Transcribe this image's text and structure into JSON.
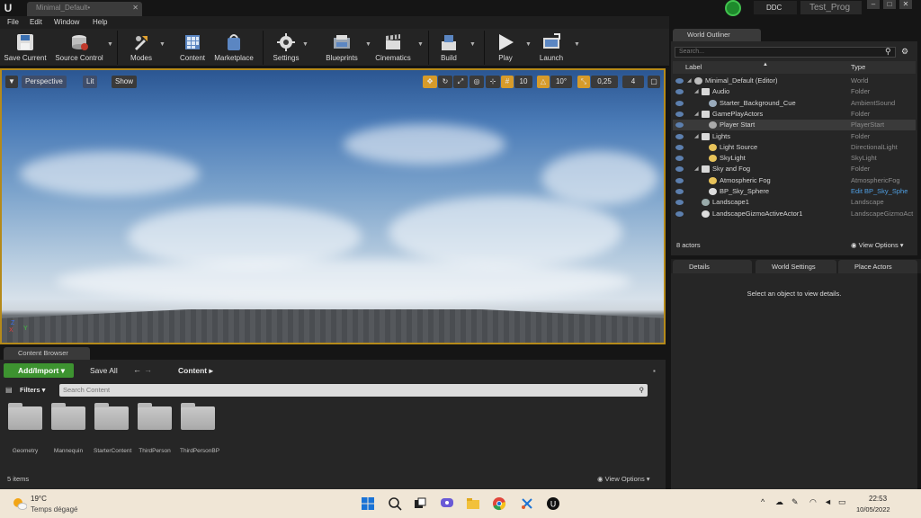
{
  "titlebar": {
    "document_tab": "Minimal_Default•",
    "ddc_label": "DDC",
    "project_name": "Test_Prog"
  },
  "menu": [
    "File",
    "Edit",
    "Window",
    "Help"
  ],
  "toolbar": {
    "buttons": [
      {
        "label": "Save Current",
        "icon": "save-icon"
      },
      {
        "label": "Source Control",
        "icon": "source-control-icon"
      },
      {
        "label": "Modes",
        "icon": "modes-icon"
      },
      {
        "label": "Content",
        "icon": "content-icon"
      },
      {
        "label": "Marketplace",
        "icon": "marketplace-icon"
      },
      {
        "label": "Settings",
        "icon": "settings-icon"
      },
      {
        "label": "Blueprints",
        "icon": "blueprints-icon"
      },
      {
        "label": "Cinematics",
        "icon": "cinematics-icon"
      },
      {
        "label": "Build",
        "icon": "build-icon"
      },
      {
        "label": "Play",
        "icon": "play-icon"
      },
      {
        "label": "Launch",
        "icon": "launch-icon"
      }
    ]
  },
  "viewport": {
    "perspective": "Perspective",
    "lit": "Lit",
    "show": "Show",
    "grid_snap": "10",
    "rotation_snap": "10°",
    "scale_snap": "0,25",
    "camera_speed": "4",
    "axis_x": "X",
    "axis_y": "Y",
    "axis_z": "Z"
  },
  "content_browser": {
    "tab": "Content Browser",
    "add_import": "Add/Import",
    "save_all": "Save All",
    "path": "Content",
    "filters": "Filters",
    "search_placeholder": "Search Content",
    "folders": [
      "Geometry",
      "Mannequin",
      "StarterContent",
      "ThirdPerson",
      "ThirdPersonBP"
    ],
    "item_count": "5 items",
    "view_options": "View Options"
  },
  "world_outliner": {
    "tab": "World Outliner",
    "search_placeholder": "Search...",
    "col_label": "Label",
    "col_type": "Type",
    "rows": [
      {
        "label": "Minimal_Default (Editor)",
        "type": "World",
        "depth": 0
      },
      {
        "label": "Audio",
        "type": "Folder",
        "depth": 1
      },
      {
        "label": "Starter_Background_Cue",
        "type": "AmbientSound",
        "depth": 2
      },
      {
        "label": "GamePlayActors",
        "type": "Folder",
        "depth": 1
      },
      {
        "label": "Player Start",
        "type": "PlayerStart",
        "depth": 2
      },
      {
        "label": "Lights",
        "type": "Folder",
        "depth": 1
      },
      {
        "label": "Light Source",
        "type": "DirectionalLight",
        "depth": 2
      },
      {
        "label": "SkyLight",
        "type": "SkyLight",
        "depth": 2
      },
      {
        "label": "Sky and Fog",
        "type": "Folder",
        "depth": 1
      },
      {
        "label": "Atmospheric Fog",
        "type": "AtmosphericFog",
        "depth": 2
      },
      {
        "label": "BP_Sky_Sphere",
        "type": "Edit BP_Sky_Sphe",
        "depth": 2
      },
      {
        "label": "Landscape1",
        "type": "Landscape",
        "depth": 1
      },
      {
        "label": "LandscapeGizmoActiveActor1",
        "type": "LandscapeGizmoAct",
        "depth": 1
      }
    ],
    "actor_count": "8 actors",
    "view_options": "View Options"
  },
  "details": {
    "tabs": [
      "Details",
      "World Settings",
      "Place Actors"
    ],
    "empty_message": "Select an object to view details."
  },
  "taskbar": {
    "temperature": "19°C",
    "weather": "Temps dégagé",
    "time": "22:53",
    "date": "10/05/2022"
  },
  "colors": {
    "accent_green": "#3d9330",
    "viewport_border": "#b58a1a",
    "link_blue": "#4f9fe3"
  }
}
